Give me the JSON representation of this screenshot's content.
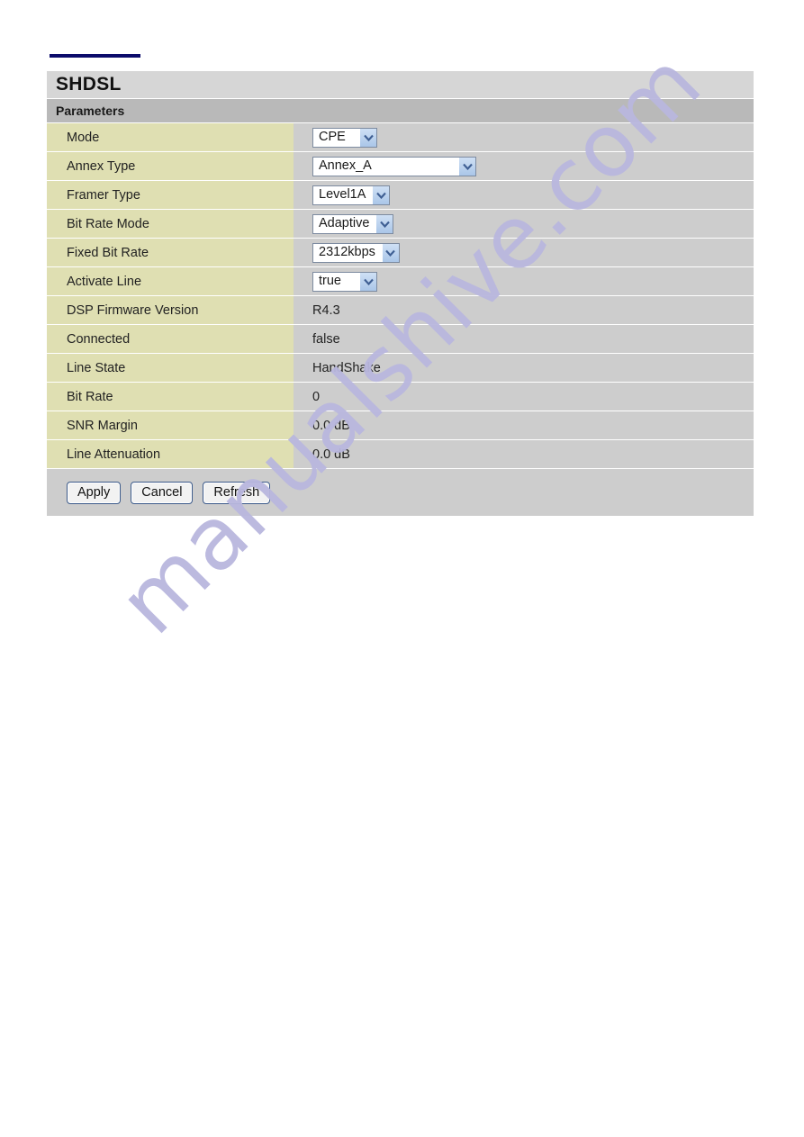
{
  "panel": {
    "title": "SHDSL",
    "section_header": "Parameters"
  },
  "rows": [
    {
      "label": "Mode",
      "type": "select",
      "value": "CPE",
      "width": "narrow"
    },
    {
      "label": "Annex Type",
      "type": "select",
      "value": "Annex_A",
      "width": "wide"
    },
    {
      "label": "Framer Type",
      "type": "select",
      "value": "Level1A",
      "width": "narrow"
    },
    {
      "label": "Bit Rate Mode",
      "type": "select",
      "value": "Adaptive",
      "width": "narrow"
    },
    {
      "label": "Fixed Bit Rate",
      "type": "select",
      "value": "2312kbps",
      "width": "narrow"
    },
    {
      "label": "Activate Line",
      "type": "select",
      "value": "true",
      "width": "narrow"
    },
    {
      "label": "DSP Firmware Version",
      "type": "text",
      "value": "R4.3"
    },
    {
      "label": "Connected",
      "type": "text",
      "value": "false"
    },
    {
      "label": "Line State",
      "type": "text",
      "value": "HandShake"
    },
    {
      "label": "Bit Rate",
      "type": "text",
      "value": "0"
    },
    {
      "label": "SNR Margin",
      "type": "text",
      "value": "0.0 dB"
    },
    {
      "label": "Line Attenuation",
      "type": "text",
      "value": "0.0 dB"
    }
  ],
  "buttons": [
    {
      "label": "Apply",
      "name": "apply-button"
    },
    {
      "label": "Cancel",
      "name": "cancel-button"
    },
    {
      "label": "Refresh",
      "name": "refresh-button"
    }
  ],
  "watermark": {
    "text": "manualshive.com",
    "color": "#b9b7de"
  },
  "colors": {
    "accent_rule": "#0b0b6b",
    "title_bar": "#d6d6d6",
    "section_bar": "#b9b9b9",
    "label_cell": "#dfdfb2",
    "value_cell": "#cdcdcd",
    "select_arrow": "#aac6e8",
    "button_border": "#3c5a8a"
  }
}
